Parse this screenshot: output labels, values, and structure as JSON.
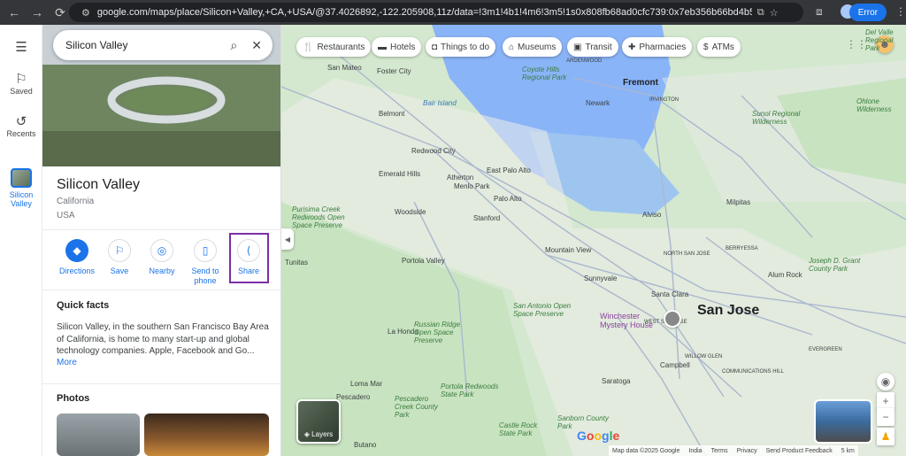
{
  "browser": {
    "url": "google.com/maps/place/Silicon+Valley,+CA,+USA/@37.4026892,-122.205908,11z/data=!3m1!4b1!4m6!3m5!1s0x808fb68ad0cfc739:0x7eb356b66bd4b50e!8m2!3d37.387474!4d-122...",
    "error_label": "Error"
  },
  "rail": {
    "saved": "Saved",
    "recents": "Recents",
    "current_line1": "Silicon",
    "current_line2": "Valley"
  },
  "search": {
    "value": "Silicon Valley"
  },
  "place": {
    "title": "Silicon Valley",
    "state": "California",
    "country": "USA"
  },
  "actions": [
    {
      "label": "Directions"
    },
    {
      "label": "Save"
    },
    {
      "label": "Nearby"
    },
    {
      "label_line1": "Send to",
      "label_line2": "phone"
    },
    {
      "label": "Share"
    }
  ],
  "quick_facts": {
    "title": "Quick facts",
    "text": "Silicon Valley, in the southern San Francisco Bay Area of California, is home to many start-up and global technology companies. Apple, Facebook and Go...",
    "more": "More"
  },
  "photos": {
    "title": "Photos"
  },
  "chips": [
    {
      "label": "Restaurants",
      "icon": "fork-knife-icon"
    },
    {
      "label": "Hotels",
      "icon": "bed-icon"
    },
    {
      "label": "Things to do",
      "icon": "camera-icon"
    },
    {
      "label": "Museums",
      "icon": "museum-icon"
    },
    {
      "label": "Transit",
      "icon": "train-icon"
    },
    {
      "label": "Pharmacies",
      "icon": "pharmacy-icon"
    },
    {
      "label": "ATMs",
      "icon": "atm-icon"
    }
  ],
  "map_labels": {
    "fremont": "Fremont",
    "san_jose": "San Jose",
    "san_mateo": "San Mateo",
    "foster_city": "Foster City",
    "belmont": "Belmont",
    "redwood_city": "Redwood City",
    "east_palo_alto": "East Palo Alto",
    "menlo_park": "Menlo Park",
    "atherton": "Atherton",
    "palo_alto": "Palo Alto",
    "stanford": "Stanford",
    "emerald_hills": "Emerald Hills",
    "woodside": "Woodside",
    "portola_valley": "Portola Valley",
    "mountain_view": "Mountain View",
    "sunnyvale": "Sunnyvale",
    "santa_clara": "Santa Clara",
    "milpitas": "Milpitas",
    "newark": "Newark",
    "alviso": "Alviso",
    "campbell": "Campbell",
    "saratoga": "Saratoga",
    "la_honda": "La Honda",
    "loma_mar": "Loma Mar",
    "pescadero": "Pescadero",
    "butano": "Butano",
    "tunitas": "Tunitas",
    "alum_rock": "Alum Rock",
    "ardenwood": "ARDENWOOD",
    "irvington": "IRVINGTON",
    "north_san_jose": "NORTH SAN JOSE",
    "berryessa": "BERRYESSA",
    "west_san_jose": "WEST SAN JOSE",
    "willow_glen": "WILLOW GLEN",
    "communications_hill": "COMMUNICATIONS HILL",
    "evergreen": "EVERGREEN",
    "bair_island": "Bair Island",
    "coyote_hills": "Coyote Hills Regional Park",
    "sunol": "Sunol Regional Wilderness",
    "del_valle": "Del Valle Regional Park",
    "ohlone": "Ohlone Wilderness",
    "purisima": "Purisima Creek Redwoods Open Space Preserve",
    "russian_ridge": "Russian Ridge Open Space Preserve",
    "san_antonio": "San Antonio Open Space Preserve",
    "sanborn": "Sanborn County Park",
    "portola_redwoods": "Portola Redwoods State Park",
    "pescadero_creek": "Pescadero Creek County Park",
    "castle_rock": "Castle Rock State Park",
    "joseph_grant": "Joseph D. Grant County Park",
    "winchester": "Winchester Mystery House"
  },
  "map_footer": {
    "map_data": "Map data ©2025 Google",
    "india": "India",
    "terms": "Terms",
    "privacy": "Privacy",
    "feedback": "Send Product Feedback",
    "scale": "5 km"
  },
  "layers_label": "Layers",
  "google_logo": "Google"
}
